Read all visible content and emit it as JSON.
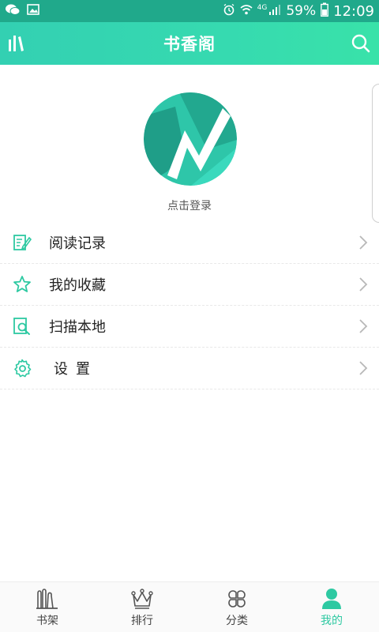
{
  "status_bar": {
    "signal_label": "4G",
    "battery_pct": "59%",
    "time": "12:09"
  },
  "header": {
    "title": "书香阁"
  },
  "profile": {
    "login_text": "点击登录"
  },
  "menu": {
    "items": [
      {
        "label": "阅读记录",
        "icon": "reading-record-icon"
      },
      {
        "label": "我的收藏",
        "icon": "star-icon"
      },
      {
        "label": "扫描本地",
        "icon": "scan-local-icon"
      },
      {
        "label": "设置",
        "icon": "gear-icon"
      }
    ]
  },
  "bottom_nav": {
    "items": [
      {
        "label": "书架",
        "icon": "bookshelf-icon"
      },
      {
        "label": "排行",
        "icon": "crown-icon"
      },
      {
        "label": "分类",
        "icon": "category-icon"
      },
      {
        "label": "我的",
        "icon": "user-icon",
        "active": true
      }
    ]
  },
  "colors": {
    "accent": "#2ec9a2",
    "header_start": "#33d0b2",
    "header_end": "#39e2a9",
    "status_bar": "#20a98b"
  }
}
